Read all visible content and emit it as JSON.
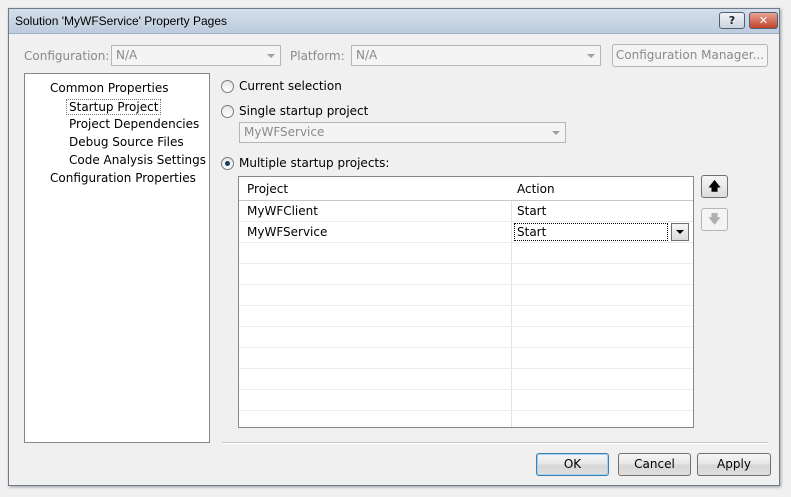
{
  "window": {
    "title": "Solution 'MyWFService' Property Pages",
    "help_glyph": "?",
    "close_glyph": "✕"
  },
  "config_bar": {
    "configuration_label": "Configuration:",
    "configuration_value": "N/A",
    "platform_label": "Platform:",
    "platform_value": "N/A",
    "manager_button": "Configuration Manager..."
  },
  "tree": {
    "items": [
      {
        "label": "Common Properties"
      },
      {
        "label": "Startup Project",
        "selected": true
      },
      {
        "label": "Project Dependencies"
      },
      {
        "label": "Debug Source Files"
      },
      {
        "label": "Code Analysis Settings"
      },
      {
        "label": "Configuration Properties"
      }
    ]
  },
  "startup": {
    "current_selection_label": "Current selection",
    "single_label": "Single startup project",
    "single_value": "MyWFService",
    "multiple_label": "Multiple startup projects:",
    "selected_option": "multiple"
  },
  "grid": {
    "headers": {
      "project": "Project",
      "action": "Action"
    },
    "rows": [
      {
        "project": "MyWFClient",
        "action": "Start"
      },
      {
        "project": "MyWFService",
        "action": "Start"
      }
    ]
  },
  "icons": {
    "move_up": "arrow-up-icon",
    "move_down": "arrow-down-icon",
    "up_glyph": "🡅",
    "down_glyph": "🡇"
  },
  "buttons": {
    "ok": "OK",
    "cancel": "Cancel",
    "apply": "Apply"
  }
}
